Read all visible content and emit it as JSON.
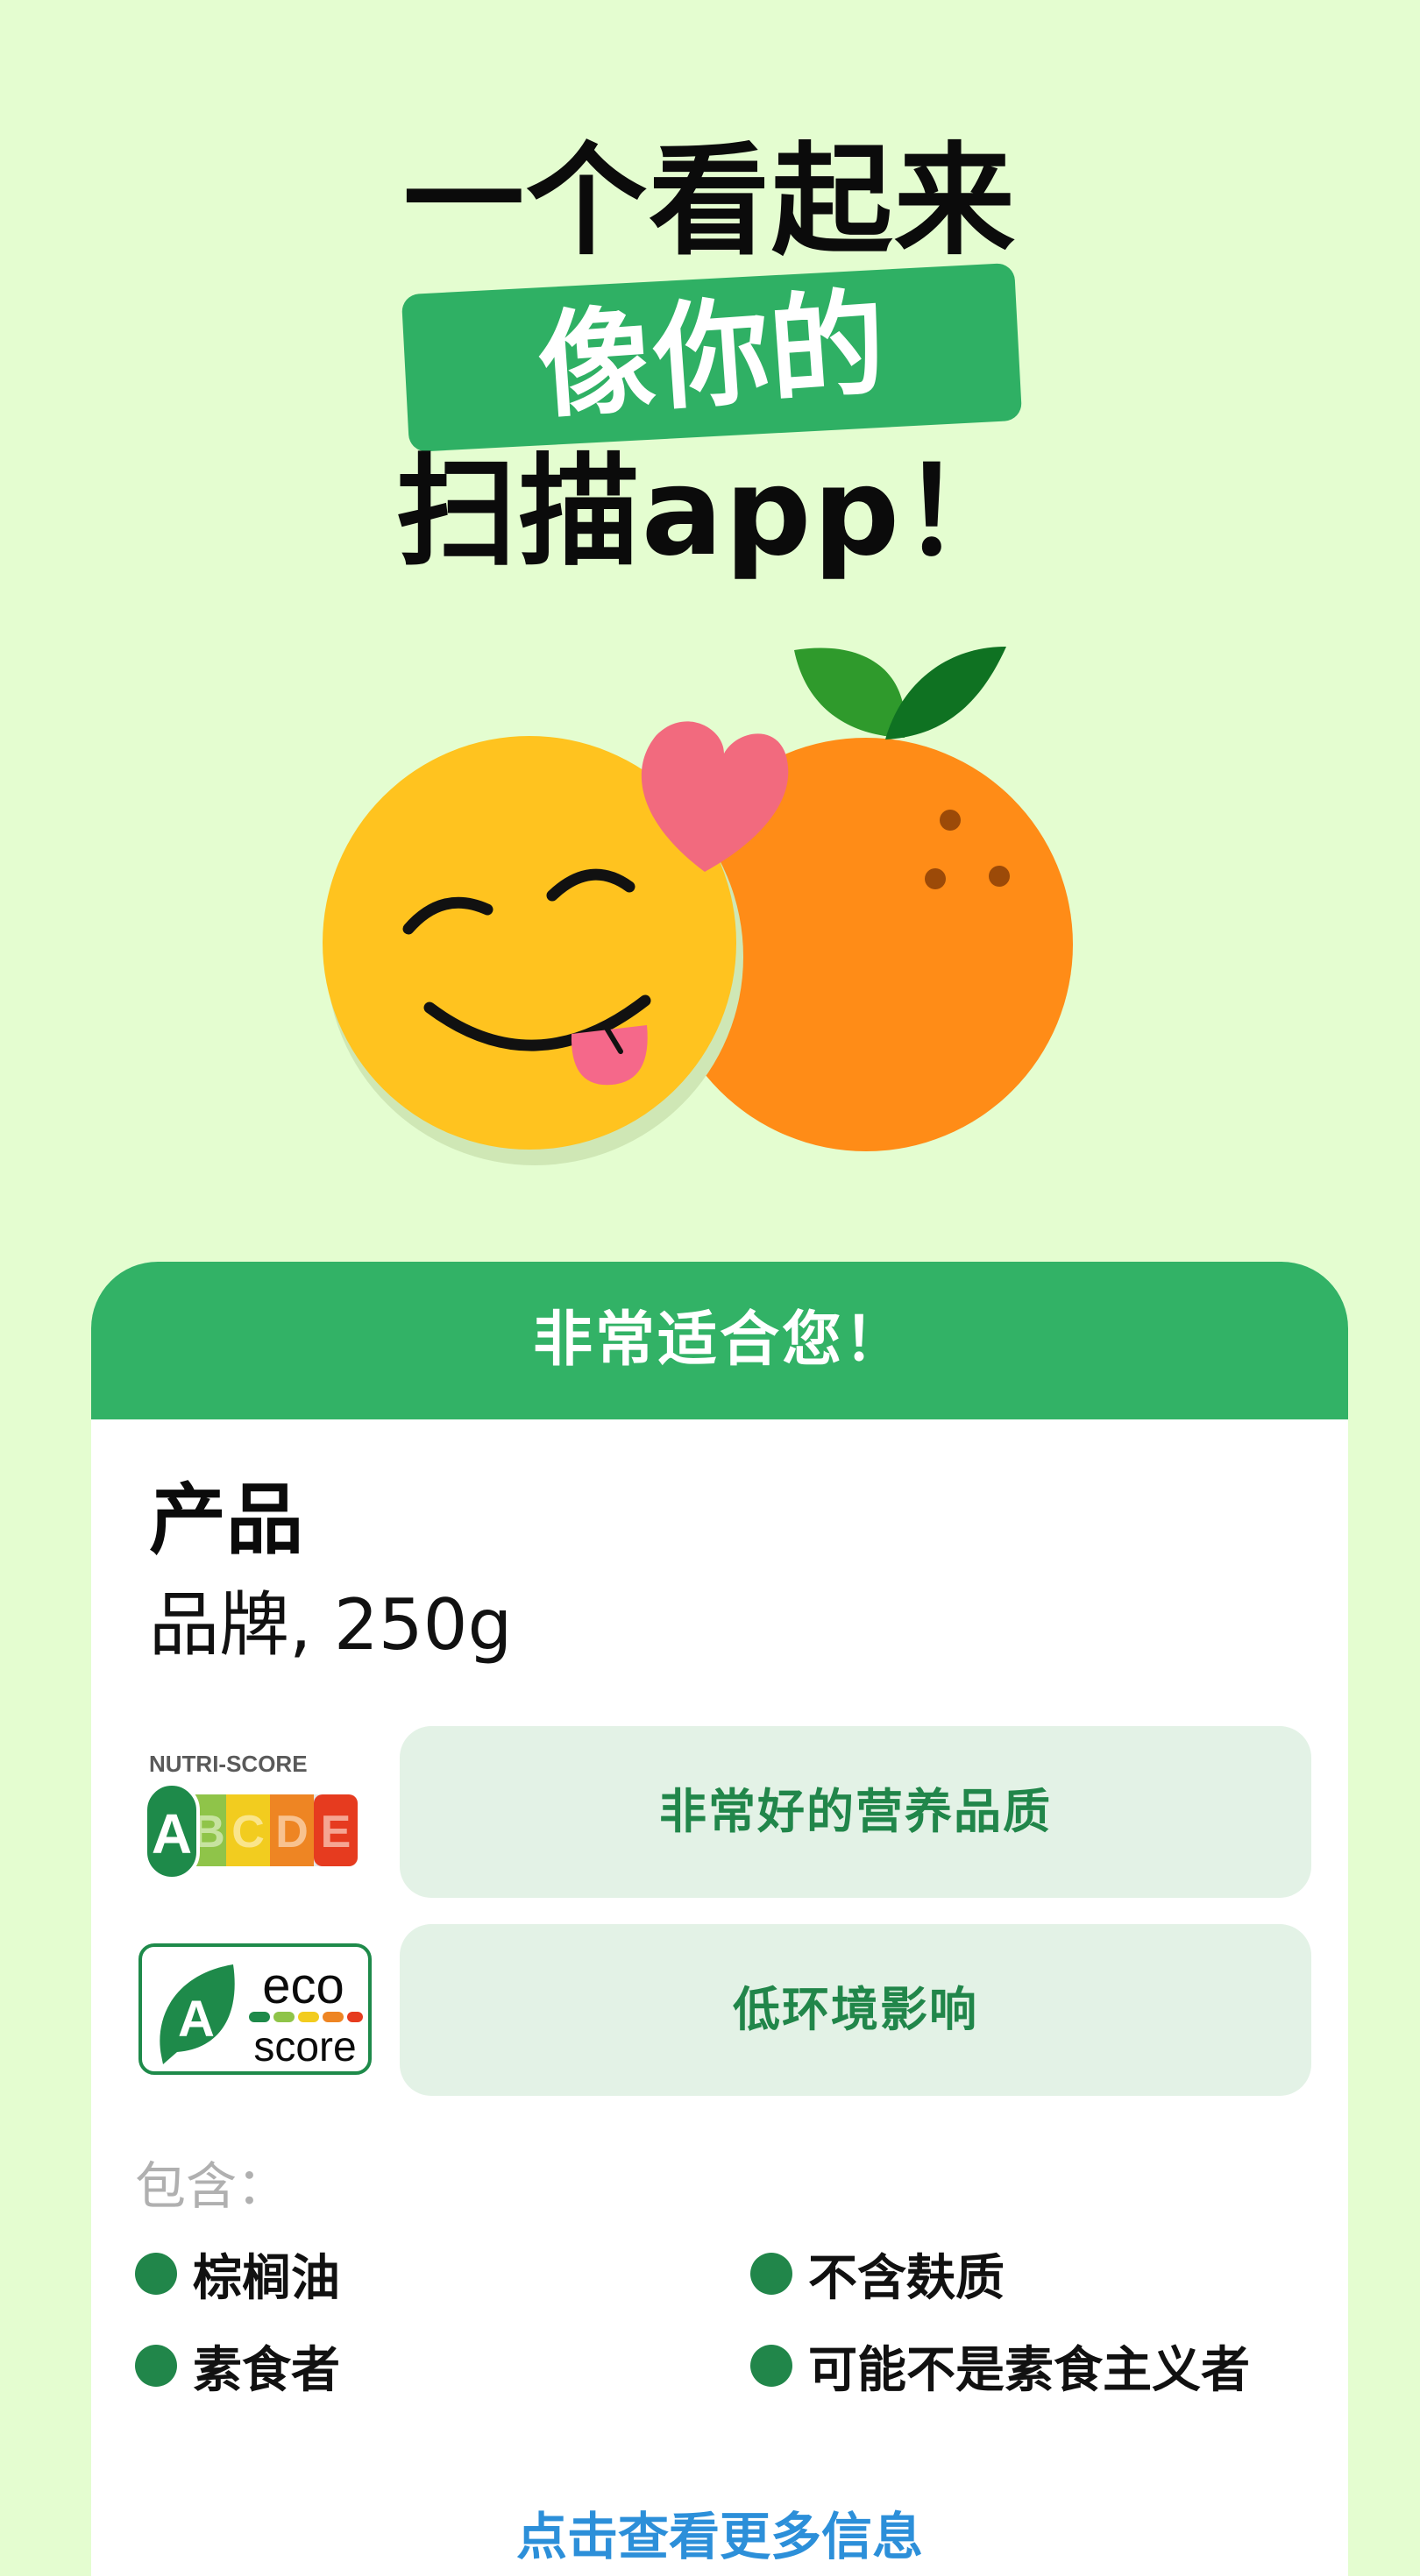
{
  "headline": {
    "line1": "一个看起来",
    "highlight": "像你的",
    "line3": "扫描app！"
  },
  "illustration": {
    "icons": [
      "smiling-face-icon",
      "heart-icon",
      "orange-icon",
      "leaf-icon"
    ]
  },
  "card": {
    "header": "非常适合您！",
    "product_name": "产品",
    "product_brand": "品牌, 250g",
    "nutri_score": {
      "logo_label": "NUTRI-SCORE",
      "grades": [
        "A",
        "B",
        "C",
        "D",
        "E"
      ],
      "active_grade": "A",
      "description": "非常好的营养品质"
    },
    "eco_score": {
      "grade": "A",
      "word1": "eco",
      "word2": "score",
      "description": "低环境影响"
    },
    "contains_label": "包含：",
    "traits": [
      "棕榈油",
      "不含麸质",
      "素食者",
      "可能不是素食主义者"
    ],
    "more_link": "点击查看更多信息"
  },
  "colors": {
    "background": "#e4fdd0",
    "brand_green": "#32b266",
    "trait_green": "#21864a",
    "pill_bg": "#e3f2e6",
    "link_blue": "#2c8fd9"
  }
}
